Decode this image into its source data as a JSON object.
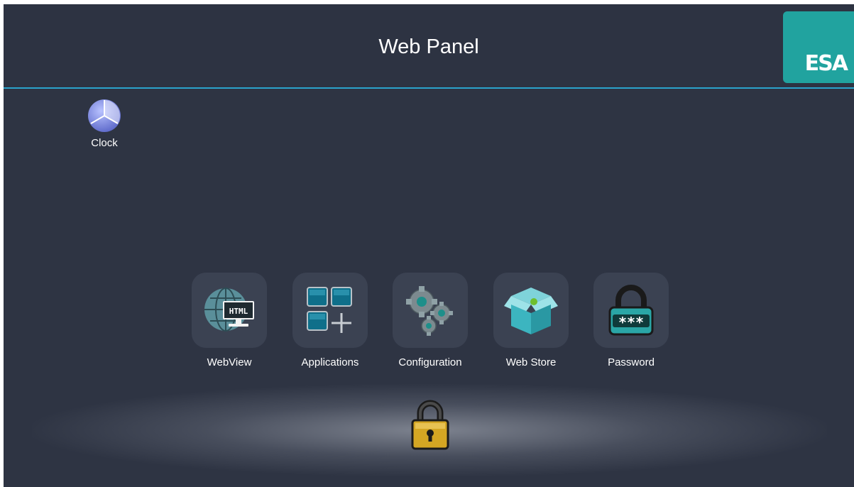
{
  "header": {
    "title": "Web Panel",
    "logo_text": "ESA"
  },
  "desktop": {
    "clock": {
      "label": "Clock",
      "icon": "clock-icon"
    }
  },
  "dock": {
    "items": [
      {
        "label": "WebView",
        "icon": "html-globe-icon",
        "badge_text": "HTML"
      },
      {
        "label": "Applications",
        "icon": "apps-grid-icon"
      },
      {
        "label": "Configuration",
        "icon": "gears-icon"
      },
      {
        "label": "Web Store",
        "icon": "store-box-icon"
      },
      {
        "label": "Password",
        "icon": "padlock-password-icon",
        "badge_text": "***"
      }
    ]
  },
  "lock": {
    "icon": "padlock-icon"
  },
  "colors": {
    "background": "#2e3443",
    "accent_line": "#2aa3cc",
    "logo_bg": "#21a39f",
    "lock_gold": "#d4a623"
  }
}
